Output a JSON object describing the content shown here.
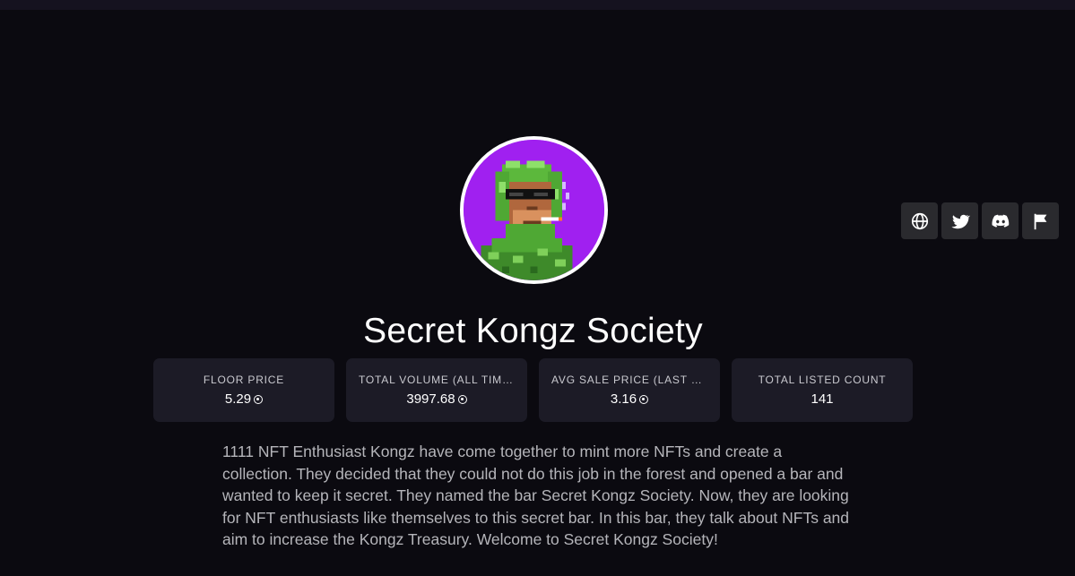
{
  "collection": {
    "name": "Secret Kongz Society",
    "avatar_icon": "kong-nft-avatar",
    "avatar_bg": "#a020f0",
    "description": "1111 NFT Enthusiast Kongz have come together to mint more NFTs and create a collection. They decided that they could not do this job in the forest and opened a bar and wanted to keep it secret. They named the bar Secret Kongz Society. Now, they are looking for NFT enthusiasts like themselves to this secret bar. In this bar, they talk about NFTs and aim to increase the Kongz Treasury. Welcome to Secret Kongz Society!"
  },
  "social_links": [
    {
      "icon": "globe-icon"
    },
    {
      "icon": "twitter-icon"
    },
    {
      "icon": "discord-icon"
    },
    {
      "icon": "flag-icon"
    }
  ],
  "stats": [
    {
      "label": "FLOOR PRICE",
      "value": "5.29",
      "currency_icon": "sol-icon"
    },
    {
      "label": "TOTAL VOLUME (ALL TIME,...",
      "value": "3997.68",
      "currency_icon": "sol-icon"
    },
    {
      "label": "AVG SALE PRICE (LAST 24...",
      "value": "3.16",
      "currency_icon": "sol-icon"
    },
    {
      "label": "TOTAL LISTED COUNT",
      "value": "141"
    }
  ],
  "colors": {
    "background": "#0b0a10",
    "card": "#1c1b26",
    "social_button": "#2a2a2e"
  }
}
